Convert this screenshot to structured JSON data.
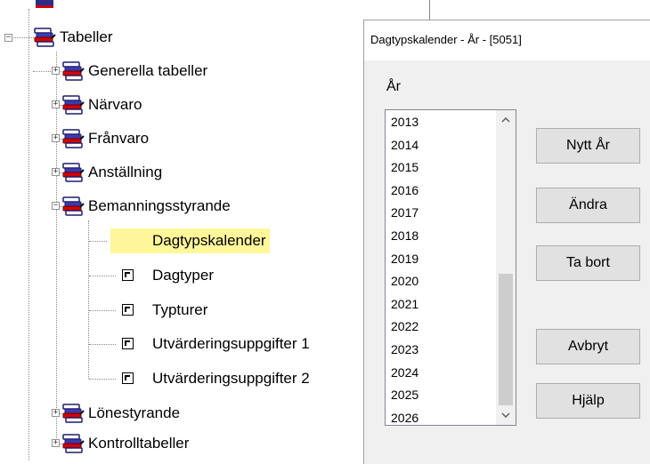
{
  "tree": {
    "root_label": "Tabeller",
    "children": [
      {
        "label": "Generella tabeller"
      },
      {
        "label": "Närvaro"
      },
      {
        "label": "Frånvaro"
      },
      {
        "label": "Anställning"
      },
      {
        "label": "Bemanningsstyrande"
      },
      {
        "label": "Lönestyrande"
      },
      {
        "label": "Kontrolltabeller"
      }
    ],
    "bemanning_leaves": [
      {
        "label": "Dagtypskalender",
        "selected": true
      },
      {
        "label": "Dagtyper"
      },
      {
        "label": "Typturer"
      },
      {
        "label": "Utvärderingsuppgifter 1"
      },
      {
        "label": "Utvärderingsuppgifter 2"
      }
    ]
  },
  "dialog": {
    "title": "Dagtypskalender - År - [5051]",
    "year_label": "År",
    "years": [
      "2013",
      "2014",
      "2015",
      "2016",
      "2017",
      "2018",
      "2019",
      "2020",
      "2021",
      "2022",
      "2023",
      "2024",
      "2025",
      "2026"
    ],
    "buttons": {
      "new_year": "Nytt År",
      "edit": "Ändra",
      "delete": "Ta bort",
      "cancel": "Avbryt",
      "help": "Hjälp"
    }
  },
  "colors": {
    "selection_highlight": "#fff79a",
    "dialog_bg": "#f0f0f0",
    "button_bg": "#e1e1e1"
  }
}
